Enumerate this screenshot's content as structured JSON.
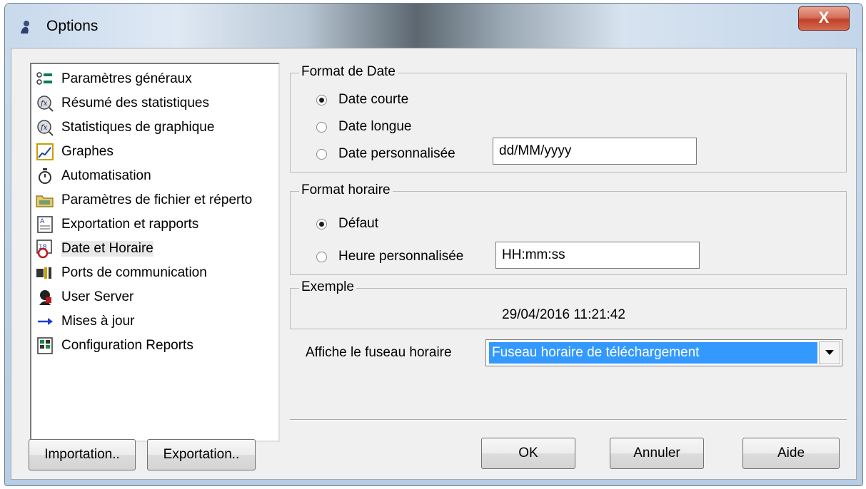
{
  "window": {
    "title": "Options",
    "close_label": "X"
  },
  "nav": {
    "items": [
      {
        "label": "Paramètres généraux",
        "icon": "settings-list-icon"
      },
      {
        "label": "Résumé des statistiques",
        "icon": "fx-magnifier-icon"
      },
      {
        "label": "Statistiques de graphique",
        "icon": "fx-magnifier-icon"
      },
      {
        "label": "Graphes",
        "icon": "graph-icon"
      },
      {
        "label": "Automatisation",
        "icon": "stopwatch-icon"
      },
      {
        "label": "Paramètres de fichier et réperto",
        "icon": "folder-icon"
      },
      {
        "label": "Exportation et rapports",
        "icon": "report-icon"
      },
      {
        "label": "Date et Horaire",
        "icon": "calendar-clock-icon"
      },
      {
        "label": "Ports de communication",
        "icon": "port-icon"
      },
      {
        "label": "User Server",
        "icon": "user-server-icon"
      },
      {
        "label": "Mises à jour",
        "icon": "arrow-right-icon"
      },
      {
        "label": "Configuration Reports",
        "icon": "spreadsheet-icon"
      }
    ],
    "selected": "Date et Horaire"
  },
  "date_format": {
    "title": "Format de Date",
    "short": "Date courte",
    "long": "Date longue",
    "custom": "Date personnalisée",
    "custom_value": "dd/MM/yyyy",
    "selected": "Date courte"
  },
  "time_format": {
    "title": "Format horaire",
    "default": "Défaut",
    "custom": "Heure personnalisée",
    "custom_value": "HH:mm:ss",
    "selected": "Défaut"
  },
  "example": {
    "title": "Exemple",
    "value": "29/04/2016 11:21:42"
  },
  "timezone": {
    "label": "Affiche le fuseau horaire",
    "selected": "Fuseau horaire de téléchargement"
  },
  "buttons": {
    "import": "Importation..",
    "export": "Exportation..",
    "ok": "OK",
    "cancel": "Annuler",
    "help": "Aide"
  },
  "colors": {
    "selection": "#3399ff",
    "close": "#c7462f",
    "dialog_bg": "#f0f0f0"
  }
}
